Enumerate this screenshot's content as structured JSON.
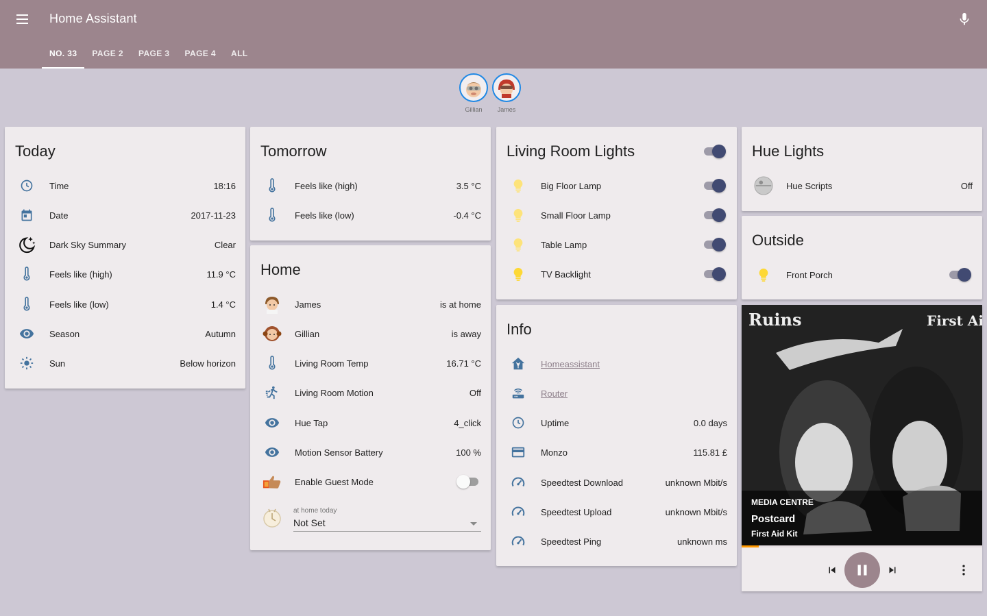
{
  "app": {
    "title": "Home Assistant"
  },
  "tabs": [
    {
      "label": "NO. 33",
      "active": true
    },
    {
      "label": "PAGE 2",
      "active": false
    },
    {
      "label": "PAGE 3",
      "active": false
    },
    {
      "label": "PAGE 4",
      "active": false
    },
    {
      "label": "ALL",
      "active": false
    }
  ],
  "badges": [
    {
      "label": "Gillian"
    },
    {
      "label": "James"
    }
  ],
  "today": {
    "title": "Today",
    "rows": [
      {
        "icon": "clock-icon",
        "name": "Time",
        "value": "18:16"
      },
      {
        "icon": "calendar-icon",
        "name": "Date",
        "value": "2017-11-23"
      },
      {
        "icon": "moon-stars-icon",
        "name": "Dark Sky Summary",
        "value": "Clear"
      },
      {
        "icon": "thermometer-icon",
        "name": "Feels like (high)",
        "value": "11.9 °C"
      },
      {
        "icon": "thermometer-icon",
        "name": "Feels like (low)",
        "value": "1.4 °C"
      },
      {
        "icon": "eye-icon",
        "name": "Season",
        "value": "Autumn"
      },
      {
        "icon": "sun-icon",
        "name": "Sun",
        "value": "Below horizon"
      }
    ]
  },
  "tomorrow": {
    "title": "Tomorrow",
    "rows": [
      {
        "icon": "thermometer-icon",
        "name": "Feels like (high)",
        "value": "3.5 °C"
      },
      {
        "icon": "thermometer-icon",
        "name": "Feels like (low)",
        "value": "-0.4 °C"
      }
    ]
  },
  "home": {
    "title": "Home",
    "rows": [
      {
        "icon": "person-avatar-icon",
        "name": "James",
        "value": "is at home"
      },
      {
        "icon": "person-avatar-icon",
        "name": "Gillian",
        "value": "is away"
      },
      {
        "icon": "thermometer-icon",
        "name": "Living Room Temp",
        "value": "16.71 °C"
      },
      {
        "icon": "running-person-icon",
        "name": "Living Room Motion",
        "value": "Off"
      },
      {
        "icon": "eye-icon",
        "name": "Hue Tap",
        "value": "4_click"
      },
      {
        "icon": "eye-icon",
        "name": "Motion Sensor Battery",
        "value": "100 %"
      },
      {
        "icon": "thumbs-up-icon",
        "name": "Enable Guest Mode",
        "toggle": false
      }
    ],
    "select": {
      "label": "at home today",
      "value": "Not Set"
    }
  },
  "living_room": {
    "title": "Living Room Lights",
    "master_on": true,
    "rows": [
      {
        "icon": "bulb-icon",
        "name": "Big Floor Lamp",
        "on": true
      },
      {
        "icon": "bulb-icon",
        "name": "Small Floor Lamp",
        "on": true
      },
      {
        "icon": "bulb-icon",
        "name": "Table Lamp",
        "on": true
      },
      {
        "icon": "bulb-icon",
        "name": "TV Backlight",
        "on": true
      }
    ]
  },
  "info": {
    "title": "Info",
    "rows": [
      {
        "icon": "home-assistant-icon",
        "name": "Homeassistant",
        "link": true
      },
      {
        "icon": "router-icon",
        "name": "Router",
        "link": true
      },
      {
        "icon": "clock-icon",
        "name": "Uptime",
        "value": "0.0 days"
      },
      {
        "icon": "credit-card-icon",
        "name": "Monzo",
        "value": "115.81 £"
      },
      {
        "icon": "speedometer-icon",
        "name": "Speedtest Download",
        "value": "unknown Mbit/s"
      },
      {
        "icon": "speedometer-icon",
        "name": "Speedtest Upload",
        "value": "unknown Mbit/s"
      },
      {
        "icon": "speedometer-icon",
        "name": "Speedtest Ping",
        "value": "unknown ms"
      }
    ]
  },
  "hue": {
    "title": "Hue Lights",
    "rows": [
      {
        "icon": "hue-scripts-icon",
        "name": "Hue Scripts",
        "value": "Off"
      }
    ]
  },
  "outside": {
    "title": "Outside",
    "rows": [
      {
        "icon": "bulb-icon",
        "name": "Front Porch",
        "on": true
      }
    ]
  },
  "media": {
    "art_text_left": "Ruins",
    "art_text_right": "First Aid Kit",
    "source": "MEDIA CENTRE",
    "title": "Postcard",
    "artist": "First Aid Kit",
    "progress": 0.07,
    "playing": true
  },
  "colors": {
    "header": "#9c858d",
    "background": "#cdc8d4",
    "card": "#efebed",
    "icon_blue": "#44739e",
    "toggle_knob": "#414a72",
    "bulb_on": "#fdd835",
    "progress": "#ff9800"
  }
}
